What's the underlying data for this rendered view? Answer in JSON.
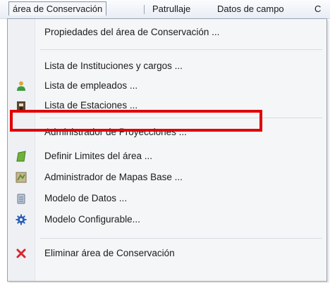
{
  "menubar": {
    "items": [
      "área de Conservación",
      "Patrullaje",
      "Datos de campo",
      "C"
    ]
  },
  "menu": {
    "items": [
      {
        "label": "Propiedades del área de Conservación ...",
        "icon": "none"
      },
      {
        "label": "Lista de Instituciones y cargos ...",
        "icon": "none"
      },
      {
        "label": "Lista de empleados ...",
        "icon": "users-icon"
      },
      {
        "label": "Lista de Estaciones ...",
        "icon": "station-icon"
      },
      {
        "label": "Administrador de Proyecciones ...",
        "icon": "none",
        "highlighted": true
      },
      {
        "label": "Definir Limites del área ...",
        "icon": "boundary-icon"
      },
      {
        "label": "Administrador de Mapas Base ...",
        "icon": "basemap-icon"
      },
      {
        "label": "Modelo de Datos ...",
        "icon": "database-icon"
      },
      {
        "label": "Modelo Configurable...",
        "icon": "gear-icon"
      },
      {
        "label": "Eliminar área de Conservación",
        "icon": "delete-x-icon"
      }
    ]
  },
  "colors": {
    "highlight_box": "#e00000",
    "delete_icon": "#d9262c",
    "gear_icon": "#2b5fb8"
  }
}
